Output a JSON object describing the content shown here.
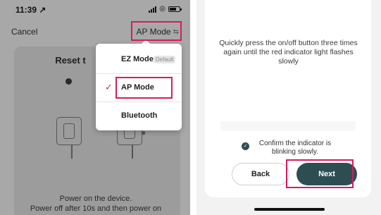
{
  "left": {
    "status": {
      "time": "11:39 ↗"
    },
    "nav": {
      "cancel_label": "Cancel",
      "mode_label": "AP Mode",
      "mode_icon": "⇆"
    },
    "card": {
      "title": "Reset t",
      "power_line1": "Power on the device.",
      "power_line2": "Power off after 10s and then power on"
    },
    "dropdown": {
      "items": [
        {
          "label": "EZ Mode",
          "badge": "Default"
        },
        {
          "label": "AP Mode",
          "check": "✓"
        },
        {
          "label": "Bluetooth"
        }
      ]
    }
  },
  "right": {
    "description": "Quickly press the on/off button three times again until the red indicator light flashes slowly",
    "confirm_text": "Confirm the indicator is blinking slowly.",
    "confirm_check": "✓",
    "back_label": "Back",
    "next_label": "Next"
  },
  "colors": {
    "accent": "#2c4e52",
    "highlight": "#d81b60",
    "check": "#d32f4a"
  }
}
